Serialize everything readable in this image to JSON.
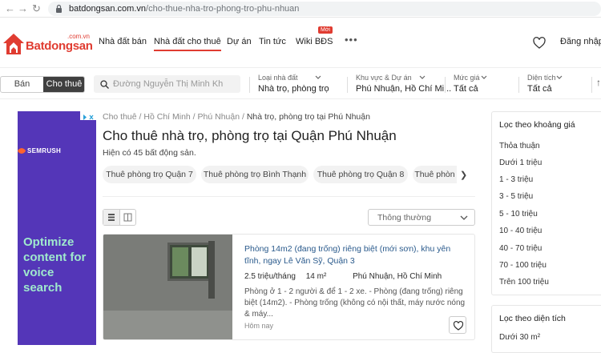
{
  "browser": {
    "url_host": "batdongsan.com.vn",
    "url_path": "/cho-thue-nha-tro-phong-tro-phu-nhuan"
  },
  "header": {
    "logo_top": ".com.vn",
    "logo_text": "Batdongsan",
    "menu": [
      "Nhà đất bán",
      "Nhà đất cho thuê",
      "Dự án",
      "Tin tức",
      "Wiki BĐS"
    ],
    "new_badge": "Mới",
    "login": "Đăng nhập"
  },
  "search": {
    "toggle": [
      "Bán",
      "Cho thuê"
    ],
    "placeholder": "Đường Nguyễn Thị Minh Kh",
    "filters": [
      {
        "label": "Loại nhà đất",
        "value": "Nhà trọ, phòng trọ"
      },
      {
        "label": "Khu vực & Dự án",
        "value": "Phú Nhuận, Hồ Chí Mi..."
      },
      {
        "label": "Mức giá",
        "value": "Tất cả"
      },
      {
        "label": "Diện tích",
        "value": "Tất cả"
      }
    ]
  },
  "ad": {
    "brand": "SEMRUSH",
    "headline": "Optimize content for voice search"
  },
  "breadcrumb": [
    "Cho thuê",
    "Hồ Chí Minh",
    "Phú Nhuận",
    "Nhà trọ, phòng trọ tại Phú Nhuận"
  ],
  "page": {
    "title": "Cho thuê nhà trọ, phòng trọ tại Quận Phú Nhuận",
    "count_text": "Hiện có 45 bất động sản."
  },
  "chips": [
    "Thuê phòng trọ Quận 7",
    "Thuê phòng trọ Bình Thạnh",
    "Thuê phòng trọ Quận 8",
    "Thuê phòn"
  ],
  "sort": "Thông thường",
  "listing": {
    "title": "Phòng 14m2 (đang trống) riêng biệt (mới sơn), khu yên tĩnh, ngay Lê Văn Sỹ, Quận 3",
    "price": "2.5 triệu/tháng",
    "area": "14 m²",
    "location": "Phú Nhuận, Hồ Chí Minh",
    "description": "Phòng ở 1 - 2 người & để 1 - 2 xe. - Phòng (đang trống) riêng biệt (14m2). - Phòng trống (không có nội thất, máy nước nóng & máy...",
    "posted": "Hôm nay"
  },
  "sidebar": {
    "price_title": "Lọc theo khoảng giá",
    "price_items": [
      "Thỏa thuận",
      "Dưới 1 triệu",
      "1 - 3 triệu",
      "3 - 5 triệu",
      "5 - 10 triệu",
      "10 - 40 triệu",
      "40 - 70 triệu",
      "70 - 100 triệu",
      "Trên 100 triệu"
    ],
    "area_title": "Lọc theo diện tích",
    "area_items": [
      "Dưới 30 m²"
    ]
  },
  "colors": {
    "brand": "#e03c31",
    "link": "#2a5a8c",
    "ad_bg": "#5436b8",
    "ad_text": "#9fe9cd"
  }
}
